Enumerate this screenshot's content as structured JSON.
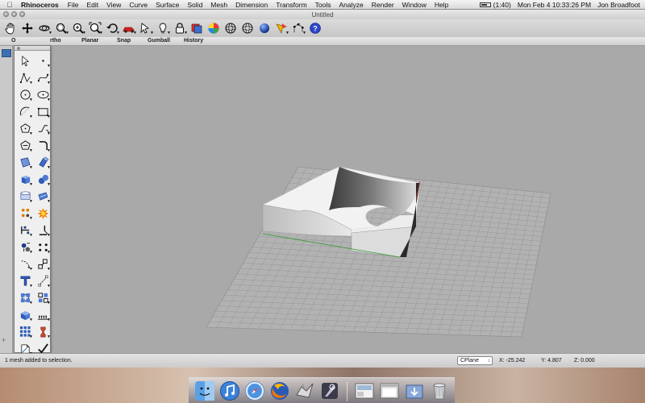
{
  "menubar": {
    "app_name": "Rhinoceros",
    "items": [
      "File",
      "Edit",
      "View",
      "Curve",
      "Surface",
      "Solid",
      "Mesh",
      "Dimension",
      "Transform",
      "Tools",
      "Analyze",
      "Render",
      "Window",
      "Help"
    ],
    "battery": "(1:40)",
    "datetime": "Mon Feb 4  10:33:26 PM",
    "user": "Jon Broadfoot"
  },
  "window": {
    "title": "Untitled"
  },
  "options": {
    "ortho": "rtho",
    "ortho_prefix": "O",
    "planar": "Planar",
    "snap": "Snap",
    "gumball": "Gumball",
    "history": "History"
  },
  "status": {
    "message": "1 mesh added to selection.",
    "cplane": "CPlane",
    "x": "X: -25.242",
    "y": "Y: 4.807",
    "z": "Z: 0.000"
  },
  "toolbar_icons": [
    "pan-hand-icon",
    "move-view-icon",
    "rotate-view-icon",
    "zoom-window-icon",
    "zoom-extents-icon",
    "zoom-selected-icon",
    "undo-view-icon",
    "car-render-icon",
    "select-icon",
    "hide-icon",
    "lock-icon",
    "layers-icon",
    "color-wheel-icon",
    "wireframe-sphere-icon",
    "shaded-sphere-icon",
    "rendered-sphere-icon",
    "osnap-icon",
    "points-on-icon",
    "help-icon"
  ],
  "palette_icons": [
    "select-arrow-icon",
    "point-icon",
    "polyline-icon",
    "curve-icon",
    "circle-icon",
    "ellipse-icon",
    "arc-icon",
    "polygon-icon",
    "rectangle-icon",
    "freeform-icon",
    "fillet-curve-icon",
    "offset-curve-icon",
    "surface-from-points-icon",
    "extrude-surface-icon",
    "box-solid-icon",
    "sphere-solid-icon",
    "cylinder-icon",
    "sweep-icon",
    "boolean-icon",
    "explode-icon",
    "split-icon",
    "trim-icon",
    "mesh-icon",
    "mirror-icon",
    "rotate-icon",
    "scale-icon",
    "text-icon",
    "dimension-icon",
    "group-icon",
    "array-icon",
    "render-icon",
    "light-icon",
    "grid-array-icon",
    "analyze-icon",
    "document-icon",
    "check-icon",
    "properties-icon",
    "paint-icon"
  ],
  "dock_icons": [
    "finder-icon",
    "itunes-icon",
    "safari-icon",
    "firefox-icon",
    "rhino-dock-icon",
    "aperture-icon",
    "preview-icon",
    "window-icon",
    "downloads-icon",
    "trash-icon"
  ]
}
